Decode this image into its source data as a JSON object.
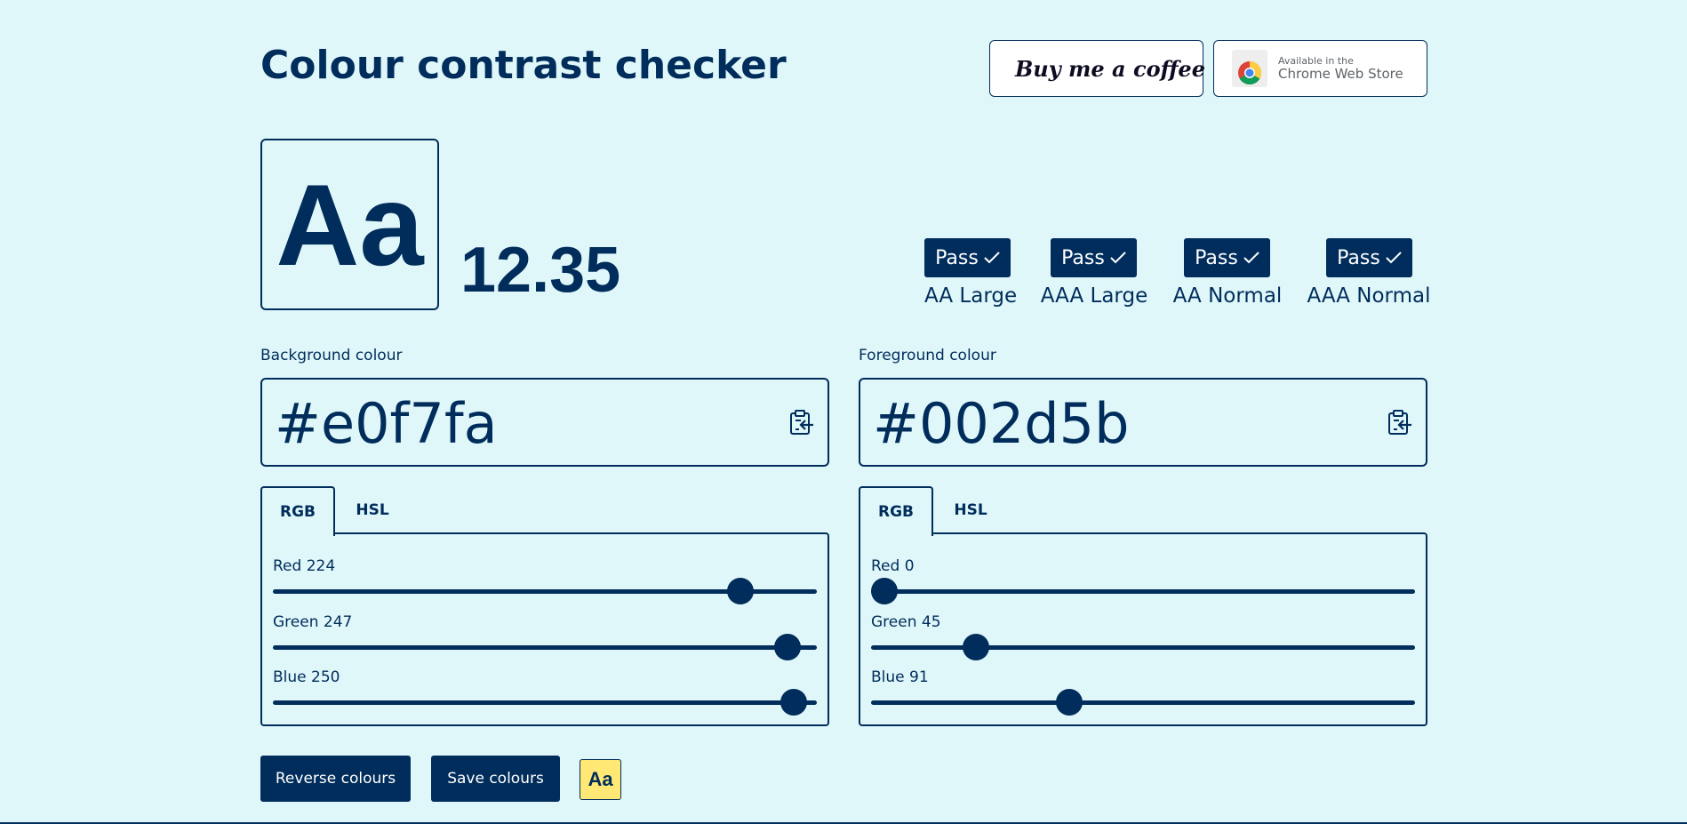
{
  "page": {
    "title": "Colour contrast checker",
    "colors": {
      "background": "#e0f7fa",
      "foreground": "#002d5b",
      "accent": "#ffe873"
    }
  },
  "header": {
    "coffee_button": {
      "label": "Buy me a coffee",
      "icon": "coffee-cup-icon"
    },
    "chrome_button": {
      "small": "Available in the",
      "label": "Chrome Web Store",
      "icon": "chrome-logo-icon"
    }
  },
  "preview": {
    "sample": "Aa",
    "ratio": "12.35"
  },
  "results": [
    {
      "status": "Pass",
      "label": "AA Large"
    },
    {
      "status": "Pass",
      "label": "AAA Large"
    },
    {
      "status": "Pass",
      "label": "AA Normal"
    },
    {
      "status": "Pass",
      "label": "AAA Normal"
    }
  ],
  "background": {
    "label": "Background colour",
    "hex": "#e0f7fa",
    "tabs": [
      "RGB",
      "HSL"
    ],
    "active_tab": "RGB",
    "sliders": [
      {
        "label": "Red 224",
        "value": 224,
        "max": 255
      },
      {
        "label": "Green 247",
        "value": 247,
        "max": 255
      },
      {
        "label": "Blue 250",
        "value": 250,
        "max": 255
      }
    ]
  },
  "foreground": {
    "label": "Foreground colour",
    "hex": "#002d5b",
    "tabs": [
      "RGB",
      "HSL"
    ],
    "active_tab": "RGB",
    "sliders": [
      {
        "label": "Red 0",
        "value": 0,
        "max": 255
      },
      {
        "label": "Green 45",
        "value": 45,
        "max": 255
      },
      {
        "label": "Blue 91",
        "value": 91,
        "max": 255
      }
    ]
  },
  "actions": {
    "reverse": "Reverse colours",
    "save": "Save colours",
    "preview_toggle": "Aa"
  }
}
